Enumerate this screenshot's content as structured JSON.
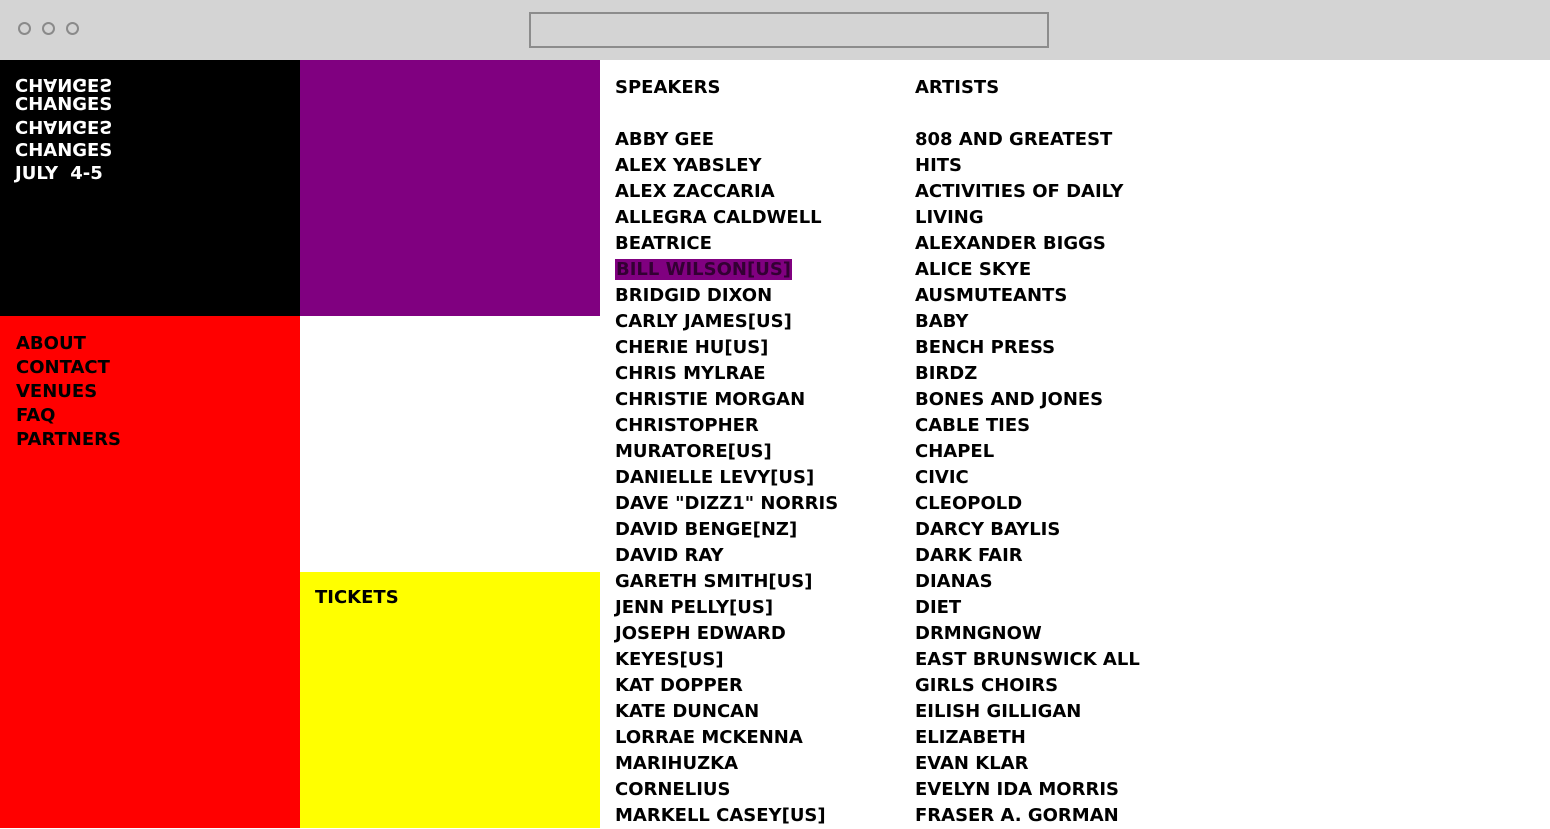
{
  "colors": {
    "chrome": "#d4d4d4",
    "logo_bg": "#000000",
    "purple": "#800080",
    "nav_bg": "#ff0000",
    "tickets_bg": "#ffff00",
    "highlight": "#800080"
  },
  "logo": {
    "lines": [
      "CHANGES",
      "CHANGES",
      "CHANGES",
      "CHANGES"
    ],
    "date": "JULY 4-5"
  },
  "nav": {
    "items": [
      "ABOUT",
      "CONTACT",
      "VENUES",
      "FAQ",
      "PARTNERS"
    ]
  },
  "tickets": {
    "label": "TICKETS"
  },
  "speakers": {
    "title": "SPEAKERS",
    "items": [
      "ABBY GEE",
      "ALEX YABSLEY",
      "ALEX ZACCARIA",
      "ALLEGRA CALDWELL",
      "BEATRICE",
      "BILL WILSON[US]",
      "BRIDGID DIXON",
      "CARLY JAMES[US]",
      "CHERIE HU[US]",
      "CHRIS MYLRAE",
      "CHRISTIE MORGAN",
      "CHRISTOPHER",
      "MURATORE[US]",
      "DANIELLE LEVY[US]",
      "DAVE \"DIZZ1\" NORRIS",
      "DAVID BENGE[NZ]",
      "DAVID RAY",
      "GARETH SMITH[US]",
      "JENN PELLY[US]",
      "JOSEPH EDWARD",
      "KEYES[US]",
      "KAT DOPPER",
      "KATE DUNCAN",
      "LORRAE MCKENNA",
      "MARIHUZKA",
      "CORNELIUS",
      "MARKELL CASEY[US]"
    ],
    "highlighted": "BILL WILSON[US]"
  },
  "artists": {
    "title": "ARTISTS",
    "items": [
      "808 AND GREATEST",
      "HITS",
      "ACTIVITIES OF DAILY",
      "LIVING",
      "ALEXANDER BIGGS",
      "ALICE SKYE",
      "AUSMUTEANTS",
      "BABY",
      "BENCH PRESS",
      "BIRDZ",
      "BONES AND JONES",
      "CABLE TIES",
      "CHAPEL",
      "CIVIC",
      "CLEOPOLD",
      "DARCY BAYLIS",
      "DARK FAIR",
      "DIANAS",
      "DIET",
      "DRMNGNOW",
      "EAST BRUNSWICK ALL",
      "GIRLS CHOIRS",
      "EILISH GILLIGAN",
      "ELIZABETH",
      "EVAN KLAR",
      "EVELYN IDA MORRIS",
      "FRASER A. GORMAN"
    ]
  }
}
